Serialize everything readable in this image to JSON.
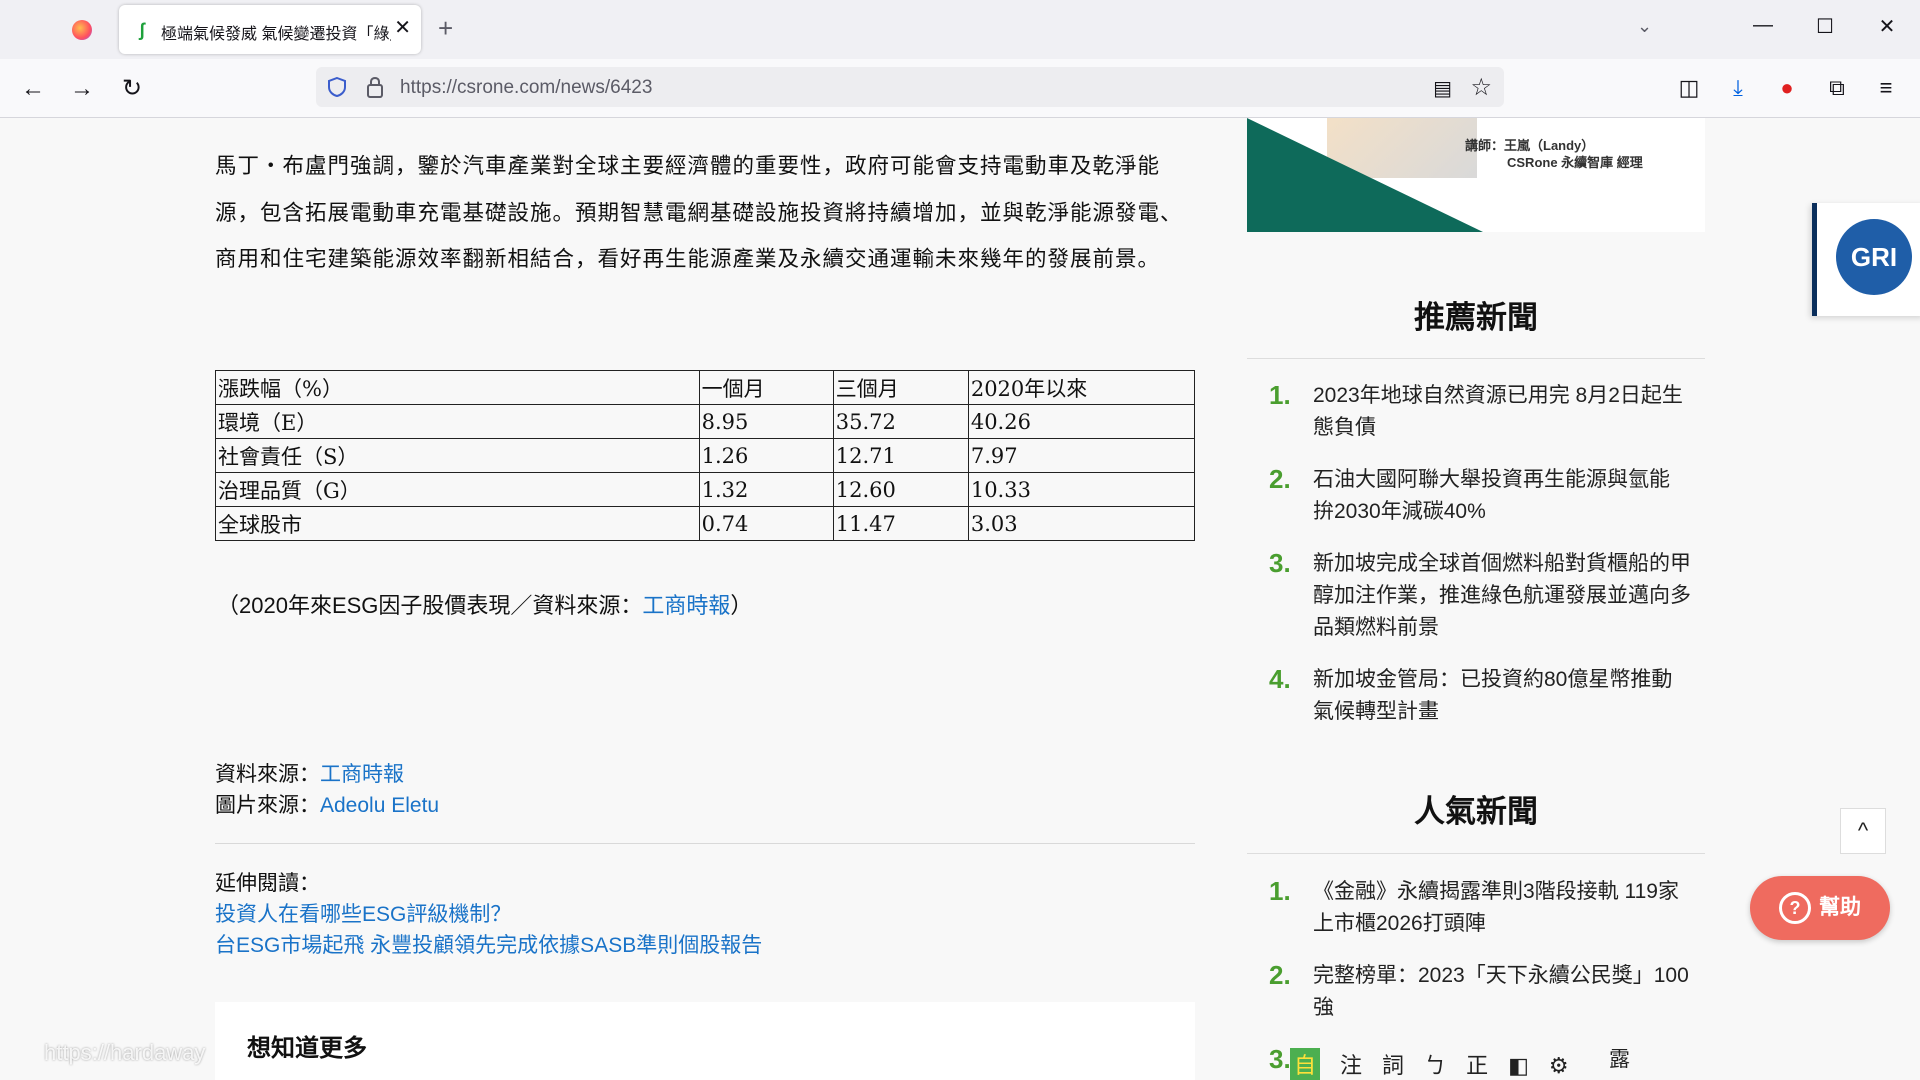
{
  "browser": {
    "tab_title": "極端氣候發威 氣候變遷投資「綠」",
    "url": "https://csrone.com/news/6423"
  },
  "article": {
    "paragraph": "馬丁・布盧門強調，鑒於汽車產業對全球主要經濟體的重要性，政府可能會支持電動車及乾淨能源，包含拓展電動車充電基礎設施。預期智慧電網基礎設施投資將持續增加，並與乾淨能源發電、商用和住宅建築能源效率翻新相結合，看好再生能源產業及永續交通運輸未來幾年的發展前景。",
    "table": {
      "headers": [
        "漲跌幅（%）",
        "一個月",
        "三個月",
        "2020年以來"
      ],
      "rows": [
        [
          "環境（E）",
          "8.95",
          "35.72",
          "40.26"
        ],
        [
          "社會責任（S）",
          "1.26",
          "12.71",
          "7.97"
        ],
        [
          "治理品質（G）",
          "1.32",
          "12.60",
          "10.33"
        ],
        [
          "全球股市",
          "0.74",
          "11.47",
          "3.03"
        ]
      ]
    },
    "caption_prefix": "（2020年來ESG因子股價表現／資料來源：",
    "caption_link": "工商時報",
    "caption_suffix": "）",
    "source_label": "資料來源：",
    "source_link": "工商時報",
    "image_source_label": "圖片來源：",
    "image_source_link": "Adeolu Eletu",
    "further_label": "延伸閱讀：",
    "further_links": [
      "投資人在看哪些ESG評級機制？",
      "台ESG市場起飛 永豐投顧領先完成依據SASB準則個股報告"
    ],
    "more_title": "想知道更多",
    "watermark": "https://hardaway"
  },
  "sidebar": {
    "banner_line1": "講師：王嵐（Landy）",
    "banner_line2": "CSRone 永續智庫 經理",
    "recommended_title": "推薦新聞",
    "recommended": [
      {
        "num": "1.",
        "text": "2023年地球自然資源已用完 8月2日起生態負債"
      },
      {
        "num": "2.",
        "text": "石油大國阿聯大舉投資再生能源與氫能 拚2030年減碳40%"
      },
      {
        "num": "3.",
        "text": "新加坡完成全球首個燃料船對貨櫃船的甲醇加注作業，推進綠色航運發展並邁向多品類燃料前景"
      },
      {
        "num": "4.",
        "text": "新加坡金管局：已投資約80億星幣推動氣候轉型計畫"
      }
    ],
    "popular_title": "人氣新聞",
    "popular": [
      {
        "num": "1.",
        "text": "《金融》永續揭露準則3階段接軌 119家上市櫃2026打頭陣"
      },
      {
        "num": "2.",
        "text": "完整榜單：2023「天下永續公民獎」100強"
      },
      {
        "num": "3.",
        "text": "露"
      }
    ]
  },
  "widgets": {
    "gri": "GRI",
    "help": "幫助",
    "help_icon": "?",
    "scroll_top": "^",
    "ime": [
      "自",
      "注",
      "詞",
      "ㄅ",
      "正",
      "◧",
      "⚙"
    ]
  },
  "colors": {
    "link": "#1a73c8",
    "number_green": "#4a9e2f",
    "help_button": "#ef6b5f",
    "gri_blue": "#1f5ea8"
  }
}
